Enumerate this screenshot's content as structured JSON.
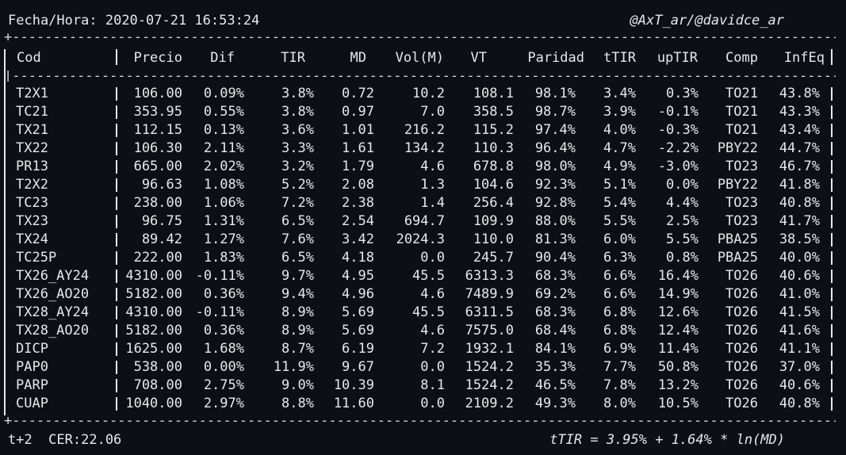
{
  "header": {
    "datetime_label": "Fecha/Hora:",
    "datetime_value": "2020-07-21 16:53:24",
    "handles": "@AxT_ar/@davidce_ar"
  },
  "table": {
    "columns": [
      "Cod",
      "Precio",
      "Dif",
      "TIR",
      "MD",
      "Vol(M)",
      "VT",
      "Paridad",
      "tTIR",
      "upTIR",
      "Comp",
      "InfEq"
    ],
    "rows": [
      [
        "T2X1",
        "106.00",
        "0.09%",
        "3.8%",
        "0.72",
        "10.2",
        "108.1",
        "98.1%",
        "3.4%",
        "0.3%",
        "TO21",
        "43.8%"
      ],
      [
        "TC21",
        "353.95",
        "0.55%",
        "3.8%",
        "0.97",
        "7.0",
        "358.5",
        "98.7%",
        "3.9%",
        "-0.1%",
        "TO21",
        "43.3%"
      ],
      [
        "TX21",
        "112.15",
        "0.13%",
        "3.6%",
        "1.01",
        "216.2",
        "115.2",
        "97.4%",
        "4.0%",
        "-0.3%",
        "TO21",
        "43.4%"
      ],
      [
        "TX22",
        "106.30",
        "2.11%",
        "3.3%",
        "1.61",
        "134.2",
        "110.3",
        "96.4%",
        "4.7%",
        "-2.2%",
        "PBY22",
        "44.7%"
      ],
      [
        "PR13",
        "665.00",
        "2.02%",
        "3.2%",
        "1.79",
        "4.6",
        "678.8",
        "98.0%",
        "4.9%",
        "-3.0%",
        "TO23",
        "46.7%"
      ],
      [
        "T2X2",
        "96.63",
        "1.08%",
        "5.2%",
        "2.08",
        "1.3",
        "104.6",
        "92.3%",
        "5.1%",
        "0.0%",
        "PBY22",
        "41.8%"
      ],
      [
        "TC23",
        "238.00",
        "1.06%",
        "7.2%",
        "2.38",
        "1.4",
        "256.4",
        "92.8%",
        "5.4%",
        "4.4%",
        "TO23",
        "40.8%"
      ],
      [
        "TX23",
        "96.75",
        "1.31%",
        "6.5%",
        "2.54",
        "694.7",
        "109.9",
        "88.0%",
        "5.5%",
        "2.5%",
        "TO23",
        "41.7%"
      ],
      [
        "TX24",
        "89.42",
        "1.27%",
        "7.6%",
        "3.42",
        "2024.3",
        "110.0",
        "81.3%",
        "6.0%",
        "5.5%",
        "PBA25",
        "38.5%"
      ],
      [
        "TC25P",
        "222.00",
        "1.83%",
        "6.5%",
        "4.18",
        "0.0",
        "245.7",
        "90.4%",
        "6.3%",
        "0.8%",
        "PBA25",
        "40.0%"
      ],
      [
        "TX26_AY24",
        "4310.00",
        "-0.11%",
        "9.7%",
        "4.95",
        "45.5",
        "6313.3",
        "68.3%",
        "6.6%",
        "16.4%",
        "TO26",
        "40.6%"
      ],
      [
        "TX26_AO20",
        "5182.00",
        "0.36%",
        "9.4%",
        "4.96",
        "4.6",
        "7489.9",
        "69.2%",
        "6.6%",
        "14.9%",
        "TO26",
        "41.0%"
      ],
      [
        "TX28_AY24",
        "4310.00",
        "-0.11%",
        "8.9%",
        "5.69",
        "45.5",
        "6311.5",
        "68.3%",
        "6.8%",
        "12.6%",
        "TO26",
        "41.5%"
      ],
      [
        "TX28_AO20",
        "5182.00",
        "0.36%",
        "8.9%",
        "5.69",
        "4.6",
        "7575.0",
        "68.4%",
        "6.8%",
        "12.4%",
        "TO26",
        "41.6%"
      ],
      [
        "DICP",
        "1625.00",
        "1.68%",
        "8.7%",
        "6.19",
        "7.2",
        "1932.1",
        "84.1%",
        "6.9%",
        "11.4%",
        "TO26",
        "41.1%"
      ],
      [
        "PAP0",
        "538.00",
        "0.00%",
        "11.9%",
        "9.67",
        "0.0",
        "1524.2",
        "35.3%",
        "7.7%",
        "50.8%",
        "TO26",
        "37.0%"
      ],
      [
        "PARP",
        "708.00",
        "2.75%",
        "9.0%",
        "10.39",
        "8.1",
        "1524.2",
        "46.5%",
        "7.8%",
        "13.2%",
        "TO26",
        "40.6%"
      ],
      [
        "CUAP",
        "1040.00",
        "2.97%",
        "8.8%",
        "11.60",
        "0.0",
        "2109.2",
        "49.3%",
        "8.0%",
        "10.5%",
        "TO26",
        "40.8%"
      ]
    ]
  },
  "footer": {
    "left": "t+2  CER:22.06",
    "right": "tTIR = 3.95% + 1.64% * ln(MD)"
  },
  "colors": {
    "background": "#0c0f14",
    "text": "#e8e8e8"
  }
}
